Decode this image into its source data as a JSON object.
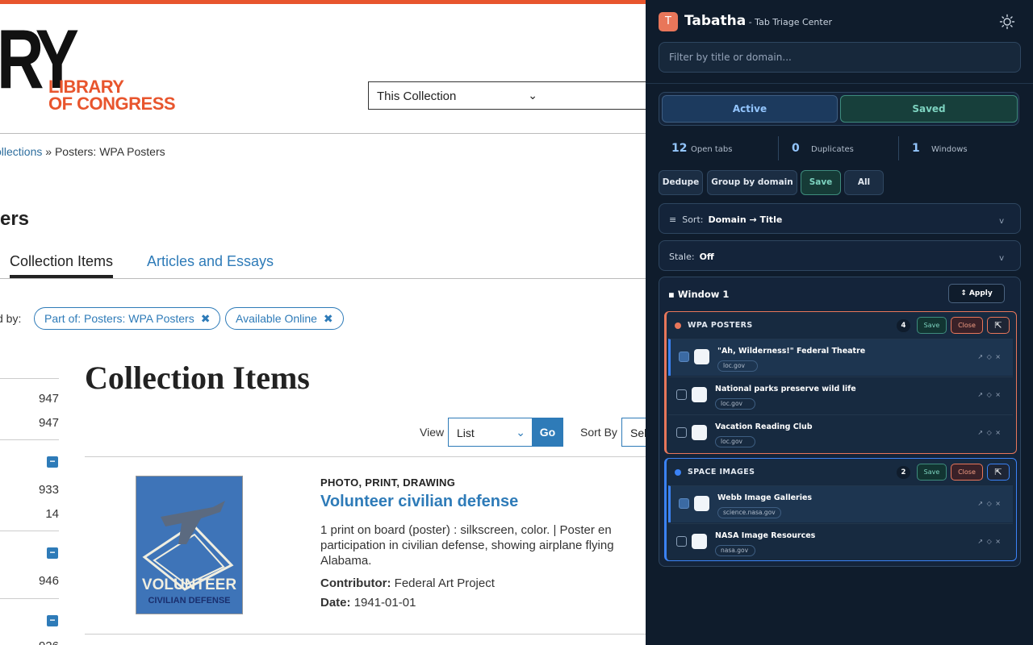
{
  "web": {
    "logo_letters": "RY",
    "logo_line1": "LIBRARY",
    "logo_line2": "OF CONGRESS",
    "scope_select": "This Collection",
    "breadcrumb_link": "ollections",
    "breadcrumb_sep": "»",
    "breadcrumb_current": "Posters: WPA Posters",
    "page_title": "ters",
    "tabs": [
      "Collection Items",
      "Articles and Essays"
    ],
    "refined_label": "d by:",
    "chips": [
      "Part of: Posters: WPA Posters",
      "Available Online"
    ],
    "facet_counts": [
      "947",
      "947",
      "933",
      "14",
      "946",
      "926"
    ],
    "heading": "Collection Items",
    "view_label": "View",
    "view_value": "List",
    "go_label": "Go",
    "sortby_label": "Sort By",
    "sortby_value": "Sel",
    "item": {
      "thumb_line1": "VOLUNTEER",
      "thumb_line2": "CIVILIAN DEFENSE",
      "type": "PHOTO, PRINT, DRAWING",
      "title": "Volunteer civilian defense",
      "description": "1 print on board (poster) : silkscreen, color. | Poster en\nparticipation in civilian defense, showing airplane flying\nAlabama.",
      "contributor_label": "Contributor:",
      "contributor": "Federal Art Project",
      "date_label": "Date:",
      "date": "1941-01-01"
    }
  },
  "panel": {
    "icon_letter": "T",
    "title": "Tabatha",
    "subtitle": " - Tab Triage Center",
    "filter_placeholder": "Filter by title or domain...",
    "tabs": {
      "active": "Active",
      "saved": "Saved"
    },
    "stats": [
      {
        "value": "12",
        "label": "Open tabs"
      },
      {
        "value": "0",
        "label": "Duplicates"
      },
      {
        "value": "1",
        "label": "Windows"
      }
    ],
    "actions": [
      "Dedupe",
      "Group by domain",
      "Save",
      "All"
    ],
    "sort_label": "Sort:",
    "sort_value": "Domain → Title",
    "stale_label": "Stale:",
    "stale_value": "Off",
    "window_title": "Window 1",
    "apply_label": "↕ Apply",
    "groups": [
      {
        "name": "WPA POSTERS",
        "count": "4",
        "save": "Save",
        "close": "Close",
        "color": "#e8765a",
        "tabs": [
          {
            "title": "\"Ah, Wilderness!\" Federal Theatre",
            "domain": "loc.gov"
          },
          {
            "title": "National parks preserve wild life",
            "domain": "loc.gov"
          },
          {
            "title": "Vacation Reading Club",
            "domain": "loc.gov"
          }
        ]
      },
      {
        "name": "SPACE IMAGES",
        "count": "2",
        "save": "Save",
        "close": "Close",
        "color": "#3b82f6",
        "tabs": [
          {
            "title": "Webb Image Galleries",
            "domain": "science.nasa.gov"
          },
          {
            "title": "NASA Image Resources",
            "domain": "nasa.gov"
          }
        ]
      }
    ],
    "row_actions": "↗ ◇ ×"
  }
}
